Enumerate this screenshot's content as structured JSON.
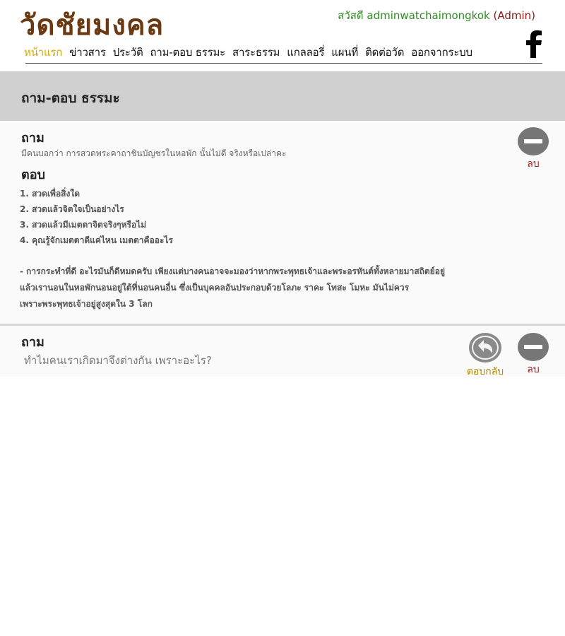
{
  "header": {
    "site_title": "วัดชัยมงคล",
    "greeting_prefix": "สวัสดี adminwatchaimongkok",
    "greeting_role": "(Admin)",
    "facebook_icon": "facebook-icon"
  },
  "nav": {
    "items": [
      "หน้าแรก",
      "ข่าวสาร",
      "ประวัติ",
      "ถาม-ตอบ ธรรมะ",
      "สาระธรรม",
      "แกลลอรี่",
      "แผนที่",
      "ติดต่อวัด",
      "ออกจากระบบ"
    ],
    "active_index": 0
  },
  "page": {
    "title": "ถาม-ตอบ ธรรมะ"
  },
  "qa": [
    {
      "question_heading": "ถาม",
      "question": "มีคนบอกว่า การสวดพระคาถาชินบัญชรในหอพัก นั้นไม่ดี จริงหรือเปล่าคะ",
      "answer_heading": "ตอบ",
      "answer_lines": [
        "1. สวดเพื่อสิ่งใด",
        "2. สวดแล้วจิตใจเป็นอย่างไร",
        "3. สวดแล้วมีเมตตาจิตจริงๆหรือไม่",
        "4. คุณรู้จักเมตตาดีแค่ไหน เมตตาคืออะไร"
      ],
      "answer_body": [
        "- การกระทำที่ดี อะไรมันก็ดีหมดครับ เพียงแต่บางคนอาจจะมองว่าหากพระพุทธเจ้าและพระอรหันต์ทั้งหลายมาสถิตย์อยู่",
        "แล้วเรานอนในหอพักนอนอยู่ใต้ที่นอนคนอื่น ซึ่งเป็นบุคคลอันประกอบด้วยโลภะ ราคะ โทสะ โมหะ มันไม่ควร",
        "เพราะพระพุทธเจ้าอยู่สูงสุดใน 3 โลก"
      ],
      "delete_label": "ลบ"
    },
    {
      "question_heading": "ถาม",
      "question": "ทำไมคนเราเกิดมาจึงต่างกัน เพราะอะไร?",
      "reply_label": "ตอบกลับ",
      "delete_label": "ลบ"
    }
  ],
  "colors": {
    "title": "#6b3a12",
    "nav_active": "#d4a800",
    "greeting": "#2e8b22",
    "admin": "#8b1a1a",
    "band": "#d0d0d0",
    "delete": "#9b1c1c",
    "reply": "#b08a00"
  }
}
